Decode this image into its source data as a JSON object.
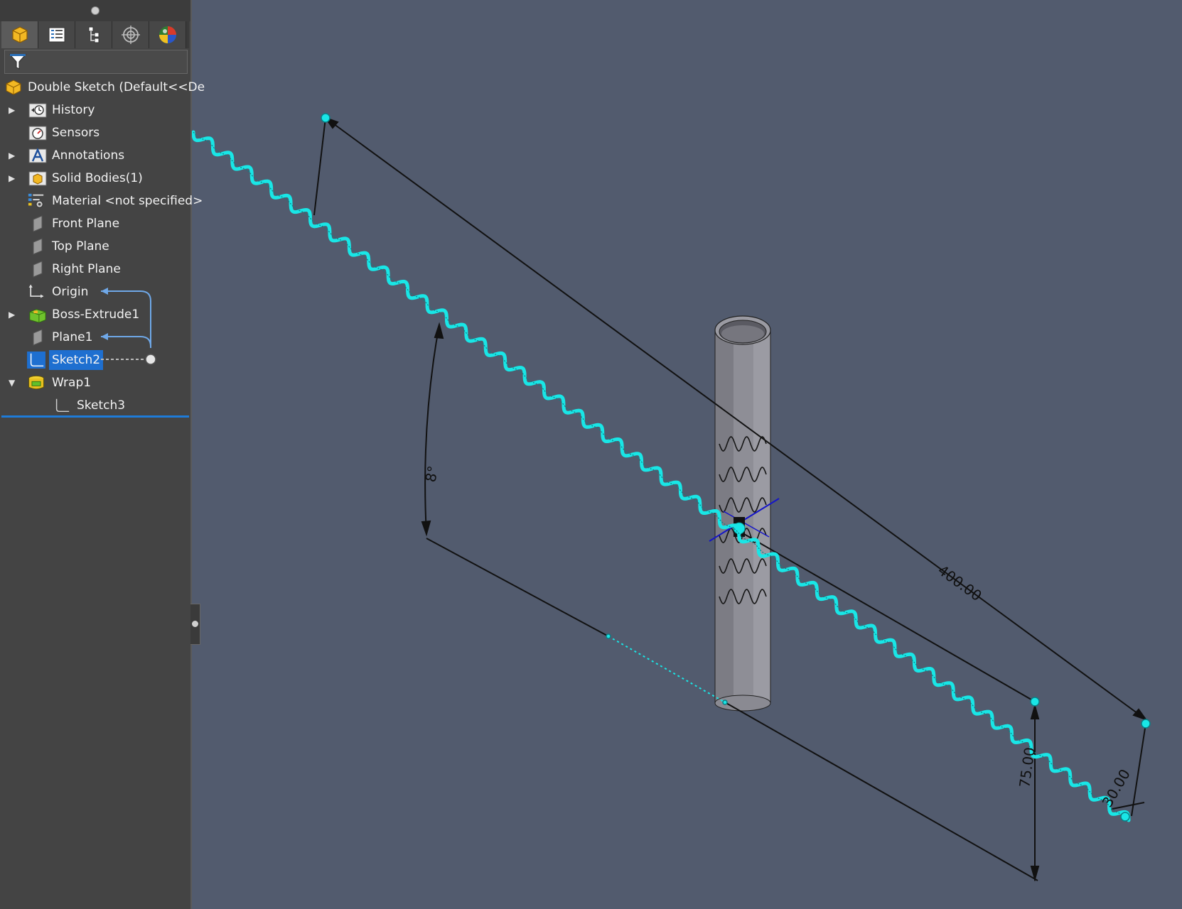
{
  "feature_tree": {
    "root": {
      "label": "Double Sketch  (Default<<De",
      "icon": "part-icon"
    },
    "items": [
      {
        "label": "History",
        "icon": "history-icon",
        "expandable": true,
        "expanded": false
      },
      {
        "label": "Sensors",
        "icon": "sensors-icon",
        "expandable": false
      },
      {
        "label": "Annotations",
        "icon": "annotations-icon",
        "expandable": true,
        "expanded": false
      },
      {
        "label": "Solid Bodies(1)",
        "icon": "solid-bodies-icon",
        "expandable": true,
        "expanded": false
      },
      {
        "label": "Material <not specified>",
        "icon": "material-icon",
        "expandable": false
      },
      {
        "label": "Front Plane",
        "icon": "plane-icon",
        "expandable": false
      },
      {
        "label": "Top Plane",
        "icon": "plane-icon",
        "expandable": false
      },
      {
        "label": "Right Plane",
        "icon": "plane-icon",
        "expandable": false
      },
      {
        "label": "Origin",
        "icon": "origin-icon",
        "expandable": false
      },
      {
        "label": "Boss-Extrude1",
        "icon": "extrude-icon",
        "expandable": true,
        "expanded": false
      },
      {
        "label": "Plane1",
        "icon": "plane-icon",
        "expandable": false
      },
      {
        "label": "Sketch2",
        "icon": "sketch-icon",
        "expandable": false,
        "selected": true
      },
      {
        "label": "Wrap1",
        "icon": "wrap-icon",
        "expandable": true,
        "expanded": true
      },
      {
        "label": "Sketch3",
        "icon": "sketch-icon",
        "expandable": false,
        "child": true
      }
    ]
  },
  "tabs": [
    {
      "name": "feature-manager-tab",
      "icon": "feature-manager-icon"
    },
    {
      "name": "property-manager-tab",
      "icon": "property-manager-icon"
    },
    {
      "name": "configuration-manager-tab",
      "icon": "configuration-manager-icon"
    },
    {
      "name": "dimxpert-manager-tab",
      "icon": "dimxpert-icon"
    },
    {
      "name": "display-manager-tab",
      "icon": "display-manager-icon"
    }
  ],
  "dimensions": {
    "angle": "8°",
    "length": "400.00",
    "height": "75.00",
    "offset": "30.00"
  },
  "colors": {
    "viewport_bg": "#525b6e",
    "panel_bg": "#444444",
    "selection": "#1e6fd0",
    "sketch_curve": "#19e6e6",
    "dimension": "#111111"
  }
}
